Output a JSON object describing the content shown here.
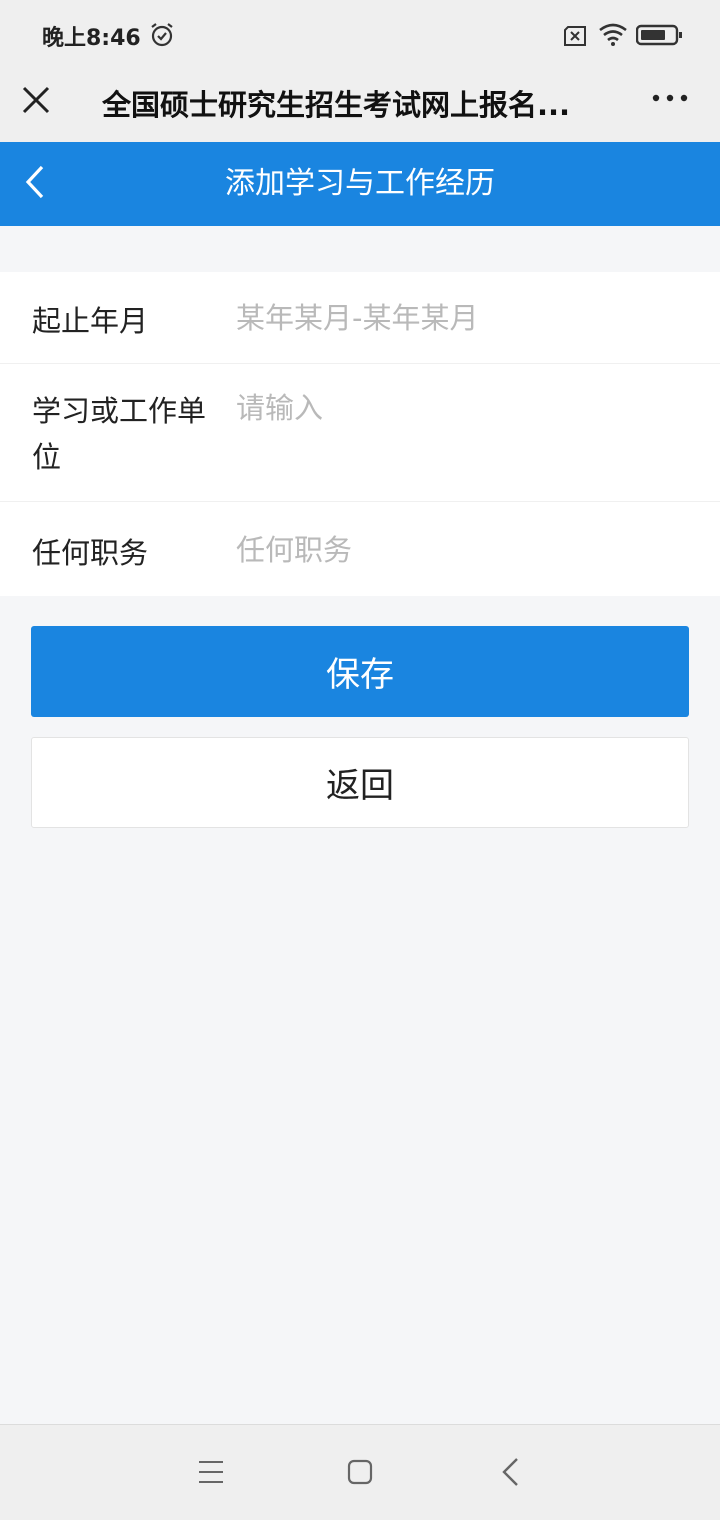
{
  "status_bar": {
    "time": "晚上8:46"
  },
  "title_bar": {
    "title": "全国硕士研究生招生考试网上报名..."
  },
  "nav_bar": {
    "title": "添加学习与工作经历"
  },
  "form": {
    "fields": [
      {
        "label": "起止年月",
        "placeholder": "某年某月-某年某月",
        "value": ""
      },
      {
        "label": "学习或工作单位",
        "placeholder": "请输入",
        "value": ""
      },
      {
        "label": "任何职务",
        "placeholder": "任何职务",
        "value": ""
      }
    ]
  },
  "buttons": {
    "save_label": "保存",
    "return_label": "返回"
  },
  "colors": {
    "accent": "#1a85e0",
    "background": "#f5f6f8",
    "placeholder": "#b9b9b9"
  },
  "icons": [
    "alarm-icon",
    "sim-icon",
    "wifi-icon",
    "battery-icon",
    "close-icon",
    "more-icon",
    "back-icon",
    "menu-icon",
    "home-icon",
    "system-back-icon"
  ]
}
